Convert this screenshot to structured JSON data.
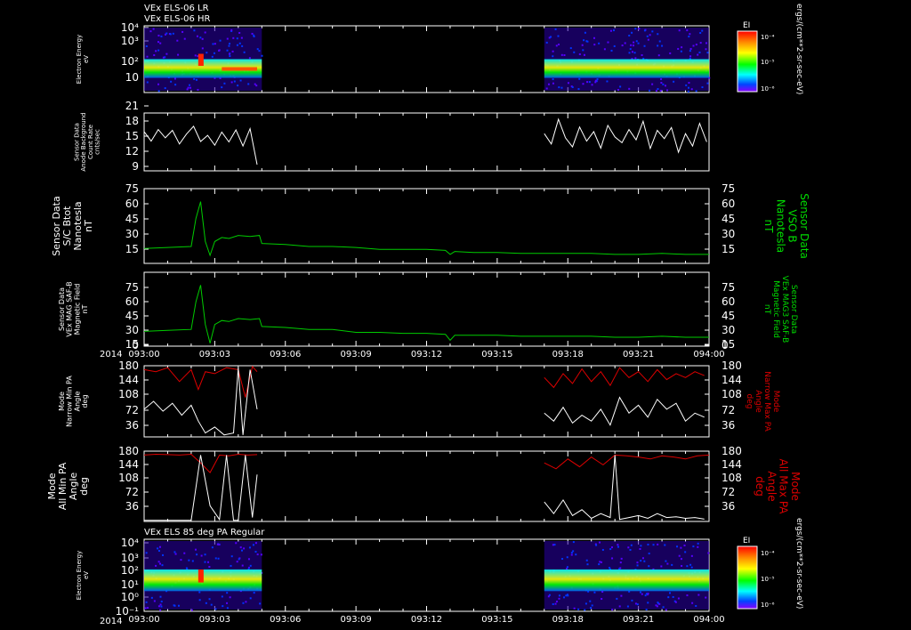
{
  "header_lines": [
    "VEx ELS-06 LR",
    "VEx ELS-06 HR"
  ],
  "bottom_panel_title": "VEx ELS 85 deg PA Regular",
  "year_label": "2014",
  "colorbar": {
    "label": "EI",
    "units": "ergs/(cm**2-sr-sec-eV)",
    "ticks": [
      "10⁻⁴",
      "10⁻⁵",
      "10⁻⁶"
    ]
  },
  "time_axis": {
    "ticks": [
      "093:00",
      "093:03",
      "093:06",
      "093:09",
      "093:12",
      "093:15",
      "093:18",
      "093:21",
      "094:00"
    ]
  },
  "colors": {
    "background": "#000000",
    "axes": "#ffffff",
    "b_trace": "#00cc00",
    "max_pa": "#dd0000",
    "min_pa": "#ffffff",
    "right_label_green": "#00dd00",
    "right_label_red": "#dd0000"
  },
  "chart_data": [
    {
      "type": "heatmap",
      "panel": "els-lr-hr-spectrogram",
      "ylabel": [
        "Electron Energy",
        "eV"
      ],
      "scale": "log",
      "ylim": [
        1,
        20000
      ],
      "yticks": [
        "10⁴",
        "10³",
        "10²",
        "10"
      ],
      "data_intervals": [
        [
          "093:00",
          "093:05"
        ],
        [
          "093:17",
          "094:00"
        ]
      ]
    },
    {
      "type": "line",
      "panel": "anode-background-count-rate",
      "ylabel": [
        "Sensor Data",
        "Anode Background",
        "Count Rate",
        "cnts/sec"
      ],
      "ylim": [
        7,
        21
      ],
      "yticks": [
        "21",
        "18",
        "15",
        "12",
        "9"
      ],
      "series": [
        {
          "segments": [
            {
              "x": [
                0.0,
                0.3,
                0.6,
                0.9,
                1.2,
                1.5,
                1.8,
                2.1,
                2.4,
                2.7,
                3.0,
                3.3,
                3.6,
                3.9,
                4.2,
                4.5,
                4.8
              ],
              "y": [
                16.5,
                14.2,
                17.0,
                15.0,
                16.8,
                13.5,
                15.9,
                17.8,
                14.1,
                15.6,
                13.2,
                16.4,
                14.0,
                16.9,
                13.0,
                17.2,
                8.5
              ]
            },
            {
              "x": [
                17.0,
                17.3,
                17.6,
                17.9,
                18.2,
                18.5,
                18.8,
                19.1,
                19.4,
                19.7,
                20.0,
                20.3,
                20.6,
                20.9,
                21.2,
                21.5,
                21.8,
                22.1,
                22.4,
                22.7,
                23.0,
                23.3,
                23.6,
                23.9
              ],
              "y": [
                16.0,
                13.5,
                19.5,
                15.0,
                12.8,
                17.6,
                14.2,
                16.5,
                12.5,
                18.0,
                15.2,
                13.8,
                17.0,
                14.5,
                19.0,
                12.4,
                16.8,
                14.8,
                17.5,
                11.5,
                16.0,
                13.0,
                18.5,
                14.0
              ]
            }
          ]
        }
      ]
    },
    {
      "type": "line",
      "panel": "b-total-sc",
      "ylabel": [
        "Sensor Data",
        "S/C Btot",
        "Nanotesla",
        "nT"
      ],
      "right_label": [
        "Sensor Data",
        "VSO B",
        "Nanotesla",
        "nT"
      ],
      "ylim": [
        0,
        75
      ],
      "yticks": [
        "75",
        "60",
        "45",
        "30",
        "15"
      ],
      "series": [
        {
          "x": [
            0.0,
            1.0,
            2.0,
            2.2,
            2.4,
            2.6,
            2.8,
            3.0,
            3.3,
            3.6,
            4.0,
            4.5,
            4.9,
            5.0,
            6.0,
            7.0,
            8.0,
            9.0,
            10.0,
            11.0,
            12.0,
            12.8,
            13.0,
            13.2,
            14.0,
            15.0,
            16.0,
            17.0,
            18.0,
            19.0,
            20.0,
            21.0,
            22.0,
            23.0,
            24.0
          ],
          "y": [
            15,
            16,
            17,
            45,
            62,
            22,
            8,
            22,
            26,
            25,
            28,
            27,
            28,
            20,
            19,
            17,
            17,
            16,
            14,
            14,
            14,
            13,
            9,
            12,
            11,
            11,
            10,
            10,
            10,
            10,
            9,
            9,
            10,
            9,
            9
          ]
        }
      ]
    },
    {
      "type": "line",
      "panel": "b-saf-magnetic-field",
      "ylabel": [
        "Sensor Data",
        "VEx MAG SAF-B",
        "Magnetic Field",
        "nT"
      ],
      "right_label": [
        "Sensor Data",
        "VEx MAG3 SAF-B",
        "Magnetic Field",
        "nT"
      ],
      "ylim": [
        0,
        75
      ],
      "yticks": [
        "75",
        "60",
        "45",
        "30",
        "15",
        "0"
      ],
      "series": [
        {
          "x": [
            0.0,
            1.0,
            2.0,
            2.2,
            2.4,
            2.6,
            2.8,
            3.0,
            3.3,
            3.6,
            4.0,
            4.5,
            4.9,
            5.0,
            6.0,
            7.0,
            8.0,
            9.0,
            10.0,
            11.0,
            12.0,
            12.8,
            13.0,
            13.2,
            14.0,
            15.0,
            16.0,
            17.0,
            18.0,
            19.0,
            20.0,
            21.0,
            22.0,
            23.0,
            24.0
          ],
          "y": [
            15,
            16,
            17,
            45,
            62,
            22,
            3,
            22,
            26,
            25,
            28,
            27,
            28,
            20,
            19,
            17,
            17,
            14,
            14,
            13,
            13,
            12,
            6,
            11,
            11,
            11,
            10,
            10,
            10,
            10,
            9,
            9,
            10,
            9,
            9
          ]
        }
      ]
    },
    {
      "type": "line",
      "panel": "narrow-pa",
      "ylabel": [
        "Mode",
        "Narrow Min PA",
        "Angle",
        "deg"
      ],
      "right_label": [
        "Mode",
        "Narrow Max PA",
        "Angle",
        "deg"
      ],
      "ylim": [
        0,
        180
      ],
      "yticks": [
        "180",
        "144",
        "108",
        "72",
        "36"
      ],
      "series": [
        {
          "name": "Narrow Max PA",
          "segments": [
            {
              "x": [
                0.0,
                0.5,
                1.0,
                1.5,
                2.0,
                2.3,
                2.6,
                3.0,
                3.5,
                4.0,
                4.3,
                4.6,
                4.8
              ],
              "y": [
                170,
                165,
                175,
                140,
                170,
                120,
                165,
                160,
                175,
                170,
                100,
                178,
                165
              ]
            },
            {
              "x": [
                17.0,
                17.4,
                17.8,
                18.2,
                18.6,
                19.0,
                19.4,
                19.8,
                20.2,
                20.6,
                21.0,
                21.4,
                21.8,
                22.2,
                22.6,
                23.0,
                23.4,
                23.8
              ],
              "y": [
                150,
                125,
                160,
                135,
                172,
                140,
                165,
                130,
                175,
                150,
                165,
                140,
                170,
                145,
                160,
                150,
                165,
                155
              ]
            }
          ]
        },
        {
          "name": "Narrow Min PA",
          "segments": [
            {
              "x": [
                0.0,
                0.4,
                0.8,
                1.2,
                1.6,
                2.0,
                2.3,
                2.6,
                3.0,
                3.4,
                3.8,
                4.0,
                4.2,
                4.5,
                4.8
              ],
              "y": [
                70,
                90,
                65,
                85,
                55,
                80,
                40,
                10,
                25,
                5,
                10,
                175,
                5,
                170,
                70
              ]
            },
            {
              "x": [
                17.0,
                17.4,
                17.8,
                18.2,
                18.6,
                19.0,
                19.4,
                19.8,
                20.2,
                20.6,
                21.0,
                21.4,
                21.8,
                22.2,
                22.6,
                23.0,
                23.4,
                23.8
              ],
              "y": [
                60,
                40,
                75,
                35,
                55,
                40,
                70,
                30,
                100,
                60,
                80,
                50,
                95,
                70,
                85,
                40,
                60,
                50
              ]
            }
          ]
        }
      ]
    },
    {
      "type": "line",
      "panel": "all-pa",
      "ylabel": [
        "Mode",
        "All Min PA",
        "Angle",
        "deg"
      ],
      "right_label": [
        "Mode",
        "All Max PA",
        "Angle",
        "deg"
      ],
      "ylim": [
        0,
        180
      ],
      "yticks": [
        "180",
        "144",
        "108",
        "72",
        "36"
      ],
      "series": [
        {
          "name": "All Max PA",
          "segments": [
            {
              "x": [
                0.0,
                0.5,
                1.0,
                1.5,
                2.0,
                2.4,
                2.8,
                3.2,
                3.6,
                4.0,
                4.4,
                4.8
              ],
              "y": [
                170,
                172,
                171,
                170,
                172,
                150,
                125,
                170,
                168,
                172,
                170,
                171
              ]
            },
            {
              "x": [
                17.0,
                17.5,
                18.0,
                18.5,
                19.0,
                19.5,
                20.0,
                20.5,
                21.0,
                21.5,
                22.0,
                22.5,
                23.0,
                23.5,
                24.0
              ],
              "y": [
                150,
                135,
                160,
                140,
                165,
                145,
                170,
                168,
                165,
                160,
                168,
                165,
                160,
                168,
                170
              ]
            }
          ]
        },
        {
          "name": "All Min PA",
          "segments": [
            {
              "x": [
                0.0,
                0.5,
                1.0,
                1.5,
                2.0,
                2.4,
                2.8,
                3.2,
                3.5,
                3.8,
                4.0,
                4.3,
                4.6,
                4.8
              ],
              "y": [
                3,
                3,
                3,
                3,
                3,
                170,
                40,
                5,
                170,
                3,
                3,
                170,
                10,
                120
              ]
            },
            {
              "x": [
                17.0,
                17.4,
                17.8,
                18.2,
                18.6,
                19.0,
                19.4,
                19.8,
                20.0,
                20.2,
                20.6,
                21.0,
                21.4,
                21.8,
                22.2,
                22.6,
                23.0,
                23.4,
                23.8
              ],
              "y": [
                50,
                20,
                55,
                15,
                30,
                8,
                20,
                10,
                170,
                5,
                10,
                15,
                8,
                20,
                10,
                12,
                8,
                10,
                6
              ]
            }
          ]
        }
      ]
    },
    {
      "type": "heatmap",
      "panel": "els-85-deg-pa-spectrogram",
      "ylabel": [
        "Electron Energy",
        "eV"
      ],
      "scale": "log",
      "ylim": [
        0.1,
        20000
      ],
      "yticks": [
        "10⁴",
        "10³",
        "10²",
        "10¹",
        "10⁰",
        "10⁻¹"
      ],
      "data_intervals": [
        [
          "093:00",
          "093:05"
        ],
        [
          "093:17",
          "094:00"
        ]
      ]
    }
  ]
}
